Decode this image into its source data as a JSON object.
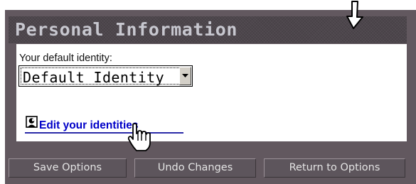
{
  "section": {
    "title": "Personal Information"
  },
  "identity": {
    "label": "Your default identity:",
    "selected_value": "Default Identity"
  },
  "edit_identities": {
    "link_text": "Edit your identities",
    "icon": "person-icon"
  },
  "footer": {
    "save_label": "Save Options",
    "undo_label": "Undo Changes",
    "return_label": "Return to Options"
  },
  "overlays": {
    "arrow_icon": "down-arrow-icon",
    "cursor_icon": "hand-pointer-icon"
  },
  "colors": {
    "frame": "#62585f",
    "header": "#4d464c",
    "title_text": "#c7c7cf",
    "link": "#0000c8",
    "button_text": "#e4e4e4"
  }
}
